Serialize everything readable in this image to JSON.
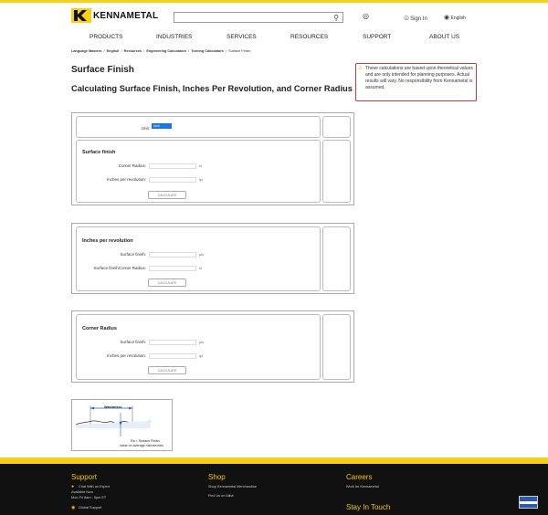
{
  "brand": {
    "name": "KENNAMETAL"
  },
  "header": {
    "search_placeholder": "",
    "sign_in": "Sign In",
    "language": "English"
  },
  "nav": [
    "PRODUCTS",
    "INDUSTRIES",
    "SERVICES",
    "RESOURCES",
    "SUPPORT",
    "ABOUT US"
  ],
  "breadcrumb": [
    "Language Masters",
    "English",
    "Resources",
    "Engineering Calculators",
    "Turning Calculators",
    "Surface Finish"
  ],
  "page": {
    "title": "Surface Finish",
    "subtitle": "Calculating Surface Finish, Inches Per Revolution, and Corner Radius"
  },
  "notice": "These calculations are based upon theoretical values and are only intended for planning purposes. Actual results will vary. No responsibility from Kennametal is assumed.",
  "unit": {
    "label": "Unit:",
    "value": "inch"
  },
  "calculators": [
    {
      "title": "Surface finish",
      "rows": [
        {
          "label": "Corner Radius:",
          "unit": "in"
        },
        {
          "label": "Inches per revolution:",
          "unit": "ipr"
        }
      ],
      "button": "CALCULATE"
    },
    {
      "title": "Inches per revolution",
      "rows": [
        {
          "label": "Surface finish:",
          "unit": "μin"
        },
        {
          "label": "Surface finishCorner Radius:",
          "unit": "in"
        }
      ],
      "button": "CALCULATE"
    },
    {
      "title": "Corner Radius",
      "rows": [
        {
          "label": "Surface finish:",
          "unit": "μin"
        },
        {
          "label": "Inches per revolution:",
          "unit": "ipr"
        }
      ],
      "button": "CALCULATE"
    }
  ],
  "diagram": {
    "top_label": "Wavinesss",
    "caption_line1": "Ra = Surface Finish",
    "caption_line2": "value on average microinches"
  },
  "footer": {
    "support": {
      "heading": "Support",
      "chat": "Chat With an Expert",
      "available": "Available Now",
      "hours": "Mon-Fri 8am - 5pm ET",
      "global": "Global Support"
    },
    "shop": {
      "heading": "Shop",
      "links": [
        "Shop Kennametal Merchandise",
        "Find Us on Alibá"
      ]
    },
    "careers": {
      "heading": "Careers",
      "links": [
        "Work for Kennametal"
      ]
    },
    "stay_in_touch": "Stay In Touch"
  },
  "colors": {
    "accent": "#f7d117",
    "unit_select": "#1e73e8",
    "notice_border": "#b9433a",
    "footer_bg": "#111111"
  }
}
